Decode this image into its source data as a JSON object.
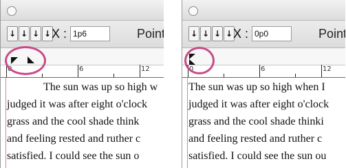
{
  "left_panel": {
    "toolbar": {
      "tab_buttons": [
        "↓",
        "↓",
        "↓",
        "↓"
      ],
      "x_label": "X :",
      "x_value": "1p6",
      "units_label": "Point"
    },
    "ruler": {
      "labels": [
        "0",
        "6",
        "12"
      ]
    },
    "text_lines": [
      "The sun was up so high w",
      "judged it was after eight o'clock",
      "grass and the cool shade think",
      "and feeling rested and ruther c",
      "satisfied. I could see the sun o"
    ]
  },
  "right_panel": {
    "toolbar": {
      "tab_buttons": [
        "↓",
        "↓",
        "↓",
        "↓"
      ],
      "x_label": "X :",
      "x_value": "0p0",
      "units_label": "Point"
    },
    "ruler": {
      "labels": [
        "0",
        "6",
        "12"
      ]
    },
    "text_lines": [
      "The sun was up so high when I",
      "judged it was after eight o'clock",
      "grass and the cool shade thinki",
      "and feeling rested and ruther c",
      "satisfied. I could see the sun ou"
    ]
  },
  "colors": {
    "highlight_circle": "#c94a86",
    "margin_guide": "#e07ab0"
  }
}
